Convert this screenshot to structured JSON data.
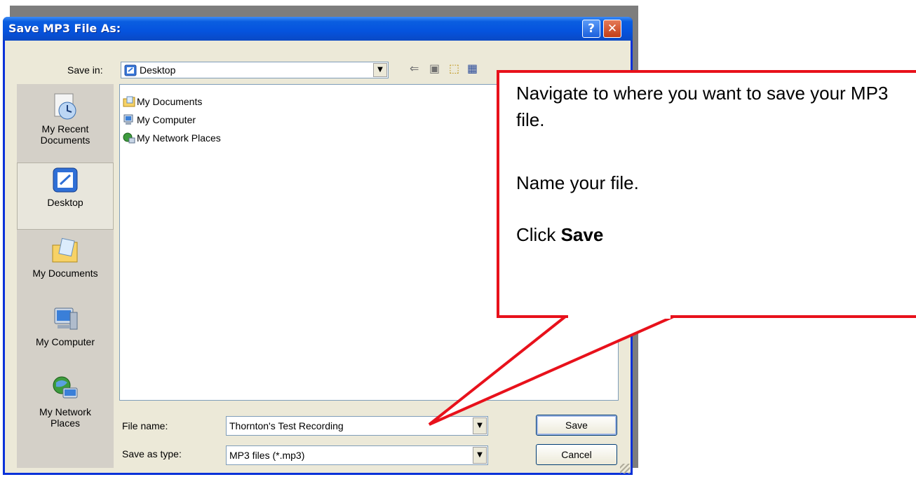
{
  "dialog": {
    "title": "Save MP3 File As:",
    "help_symbol": "?",
    "close_symbol": "✕"
  },
  "save_in": {
    "label": "Save in:",
    "value": "Desktop"
  },
  "places_bar": {
    "items": [
      {
        "label_line1": "My Recent",
        "label_line2": "Documents",
        "icon": "recent-documents-icon"
      },
      {
        "label_line1": "Desktop",
        "label_line2": "",
        "icon": "desktop-icon",
        "selected": true
      },
      {
        "label_line1": "My Documents",
        "label_line2": "",
        "icon": "my-documents-icon"
      },
      {
        "label_line1": "My Computer",
        "label_line2": "",
        "icon": "my-computer-icon"
      },
      {
        "label_line1": "My Network",
        "label_line2": "Places",
        "icon": "network-places-icon"
      }
    ]
  },
  "file_list": {
    "items": [
      {
        "label": "My Documents",
        "icon": "folder-icon"
      },
      {
        "label": "My Computer",
        "icon": "computer-icon"
      },
      {
        "label": "My Network Places",
        "icon": "network-icon"
      }
    ]
  },
  "file_name": {
    "label": "File name:",
    "value": "Thornton's Test Recording"
  },
  "save_as_type": {
    "label": "Save as type:",
    "value": "MP3 files (*.mp3)"
  },
  "buttons": {
    "save": "Save",
    "cancel": "Cancel"
  },
  "callout": {
    "line1": "Navigate to where you want to save your MP3 file.",
    "line2": "Name your file.",
    "line3_prefix": "Click ",
    "line3_bold": "Save"
  },
  "colors": {
    "titlebar": "#0553de",
    "callout_border": "#e8111b"
  }
}
